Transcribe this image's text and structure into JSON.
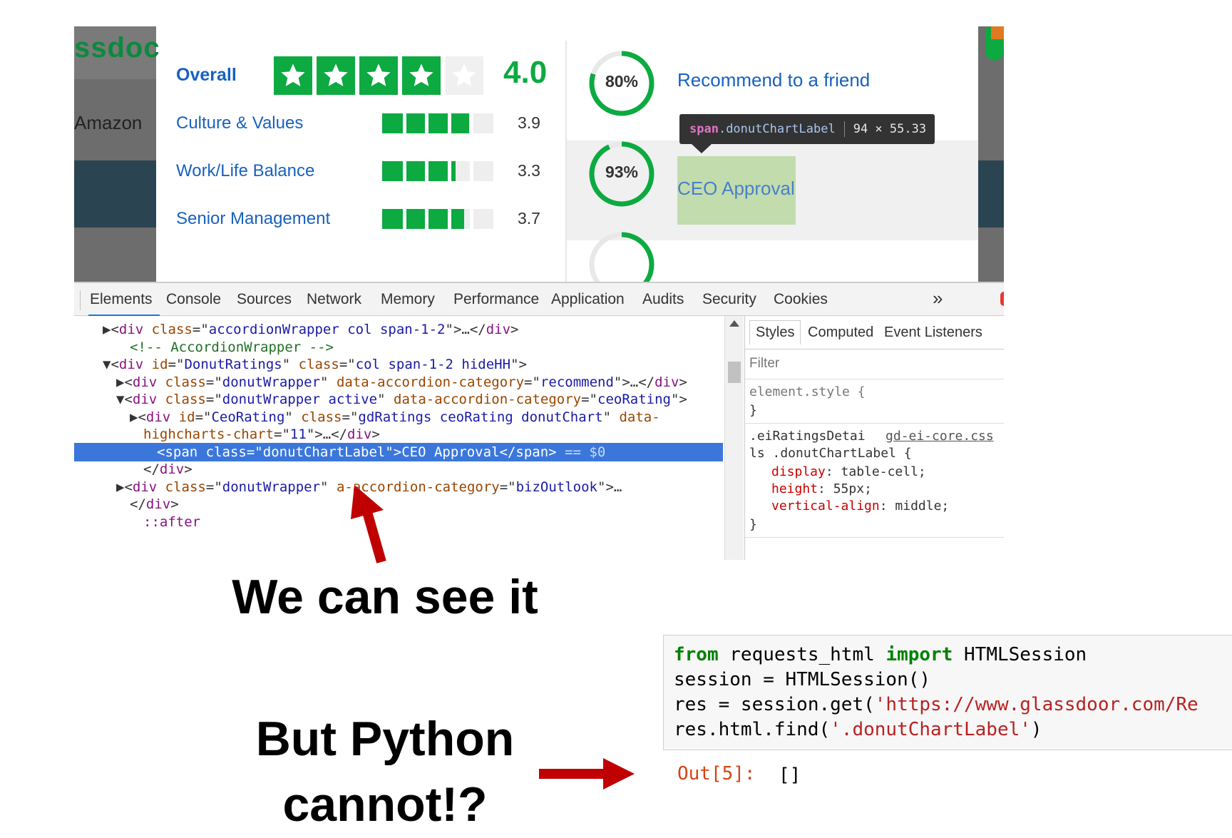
{
  "site": {
    "logo_fragment": "ssdoc",
    "company_fragment": "Amazon",
    "overall": {
      "label": "Overall",
      "value": "4.0",
      "stars": 4,
      "max_stars": 5
    },
    "ratings": [
      {
        "label": "Culture & Values",
        "value": "3.9",
        "fraction": 0.78
      },
      {
        "label": "Work/Life Balance",
        "value": "3.3",
        "fraction": 0.66
      },
      {
        "label": "Senior Management",
        "value": "3.7",
        "fraction": 0.74
      }
    ],
    "donuts": [
      {
        "percent": "80%",
        "fraction": 0.8,
        "label": "Recommend to a friend"
      },
      {
        "percent": "93%",
        "fraction": 0.93,
        "label": "CEO Approval"
      },
      {
        "percent": "",
        "fraction": 0.5,
        "label": ""
      }
    ],
    "tooltip": {
      "tag": "span",
      "class": ".donutChartLabel",
      "dims": "94 × 55.33"
    },
    "colors": {
      "green": "#0caa41",
      "link": "#1861bf"
    }
  },
  "devtools": {
    "tabs": [
      "Elements",
      "Console",
      "Sources",
      "Network",
      "Memory",
      "Performance",
      "Application",
      "Audits",
      "Security",
      "Cookies"
    ],
    "more_icon": "»",
    "dom": [
      {
        "indent": 2,
        "tri": "▶",
        "parts": [
          [
            "p",
            "<"
          ],
          [
            "t",
            "div"
          ],
          [
            "a",
            " class"
          ],
          [
            "p",
            "=\""
          ],
          [
            "v",
            "accordionWrapper col span-1-2"
          ],
          [
            "p",
            "\">…</"
          ],
          [
            "t",
            "div"
          ],
          [
            "p",
            ">"
          ]
        ]
      },
      {
        "indent": 3,
        "tri": "",
        "parts": [
          [
            "c",
            "<!-- AccordionWrapper -->"
          ]
        ]
      },
      {
        "indent": 2,
        "tri": "▼",
        "parts": [
          [
            "p",
            "<"
          ],
          [
            "t",
            "div"
          ],
          [
            "a",
            " id"
          ],
          [
            "p",
            "=\""
          ],
          [
            "v",
            "DonutRatings"
          ],
          [
            "p",
            "\""
          ],
          [
            "a",
            " class"
          ],
          [
            "p",
            "=\""
          ],
          [
            "v",
            "col span-1-2 hideHH"
          ],
          [
            "p",
            "\">"
          ]
        ]
      },
      {
        "indent": 3,
        "tri": "▶",
        "parts": [
          [
            "p",
            "<"
          ],
          [
            "t",
            "div"
          ],
          [
            "a",
            " class"
          ],
          [
            "p",
            "=\""
          ],
          [
            "v",
            "donutWrapper"
          ],
          [
            "p",
            "\""
          ],
          [
            "a",
            " data-accordion-category"
          ],
          [
            "p",
            "=\""
          ],
          [
            "v",
            "recommend"
          ],
          [
            "p",
            "\">…</"
          ],
          [
            "t",
            "div"
          ],
          [
            "p",
            ">"
          ]
        ]
      },
      {
        "indent": 3,
        "tri": "▼",
        "parts": [
          [
            "p",
            "<"
          ],
          [
            "t",
            "div"
          ],
          [
            "a",
            " class"
          ],
          [
            "p",
            "=\""
          ],
          [
            "v",
            "donutWrapper active"
          ],
          [
            "p",
            "\""
          ],
          [
            "a",
            " data-accordion-category"
          ],
          [
            "p",
            "=\""
          ],
          [
            "v",
            "ceoRating"
          ],
          [
            "p",
            "\">"
          ]
        ]
      },
      {
        "indent": 4,
        "tri": "▶",
        "parts": [
          [
            "p",
            "<"
          ],
          [
            "t",
            "div"
          ],
          [
            "a",
            " id"
          ],
          [
            "p",
            "=\""
          ],
          [
            "v",
            "CeoRating"
          ],
          [
            "p",
            "\""
          ],
          [
            "a",
            " class"
          ],
          [
            "p",
            "=\""
          ],
          [
            "v",
            "gdRatings ceoRating donutChart"
          ],
          [
            "p",
            "\""
          ],
          [
            "a",
            " data-"
          ]
        ]
      },
      {
        "indent": 4,
        "tri": "",
        "parts": [
          [
            "a",
            "highcharts-chart"
          ],
          [
            "p",
            "=\""
          ],
          [
            "v",
            "11"
          ],
          [
            "p",
            "\">…</"
          ],
          [
            "t",
            "div"
          ],
          [
            "p",
            ">"
          ]
        ]
      },
      {
        "indent": 5,
        "tri": "",
        "selected": true,
        "parts": [
          [
            "p",
            "<"
          ],
          [
            "t",
            "span"
          ],
          [
            "a",
            " class"
          ],
          [
            "p",
            "=\""
          ],
          [
            "v",
            "donutChartLabel"
          ],
          [
            "p",
            "\">"
          ],
          [
            "p",
            "CEO Approval"
          ],
          [
            "p",
            "</"
          ],
          [
            "t",
            "span"
          ],
          [
            "p",
            ">"
          ],
          [
            "dim",
            " == $0"
          ]
        ]
      },
      {
        "indent": 4,
        "tri": "",
        "parts": [
          [
            "p",
            "</"
          ],
          [
            "t",
            "div"
          ],
          [
            "p",
            ">"
          ]
        ]
      },
      {
        "indent": 3,
        "tri": "▶",
        "parts": [
          [
            "p",
            "<"
          ],
          [
            "t",
            "div"
          ],
          [
            "a",
            " class"
          ],
          [
            "p",
            "=\""
          ],
          [
            "v",
            "donutWrapper"
          ],
          [
            "p",
            "\""
          ],
          [
            "a",
            "     a-accordion-category"
          ],
          [
            "p",
            "=\""
          ],
          [
            "v",
            "bizOutlook"
          ],
          [
            "p",
            "\">…"
          ]
        ]
      },
      {
        "indent": 3,
        "tri": "",
        "parts": [
          [
            "p",
            "</"
          ],
          [
            "t",
            "div"
          ],
          [
            "p",
            ">"
          ]
        ]
      },
      {
        "indent": 4,
        "tri": "",
        "parts": [
          [
            "ps",
            "::after"
          ]
        ]
      }
    ],
    "styles": {
      "tabs": [
        "Styles",
        "Computed",
        "Event Listeners"
      ],
      "filter_placeholder": "Filter",
      "element_style_open": "element.style {",
      "element_style_close": "}",
      "rule_selector_1": ".eiRatingsDetai",
      "rule_source": "gd-ei-core.css",
      "rule_selector_2": "ls .donutChartLabel {",
      "declarations": [
        {
          "prop": "display",
          "value": "table-cell;"
        },
        {
          "prop": "height",
          "value": "55px;"
        },
        {
          "prop": "vertical-align",
          "value": "middle;"
        }
      ],
      "rule_close": "}"
    }
  },
  "annotations": {
    "see_caption": "We can see it",
    "python_caption_line1": "But Python",
    "python_caption_line2": "cannot!?",
    "arrow_color": "#c00000"
  },
  "code": {
    "lines": [
      [
        [
          "kw",
          "from"
        ],
        [
          "n",
          " requests_html "
        ],
        [
          "kw",
          "import"
        ],
        [
          "n",
          " HTMLSession"
        ]
      ],
      [
        [
          "n",
          "session = HTMLSession()"
        ]
      ],
      [
        [
          "n",
          "res = session.get("
        ],
        [
          "str",
          "'https://www.glassdoor.com/Re"
        ]
      ],
      [
        [
          "n",
          "res.html.find("
        ],
        [
          "str",
          "'.donutChartLabel'"
        ],
        [
          "n",
          ")"
        ]
      ]
    ],
    "out_prompt": "Out[5]:",
    "out_value": "[]"
  }
}
